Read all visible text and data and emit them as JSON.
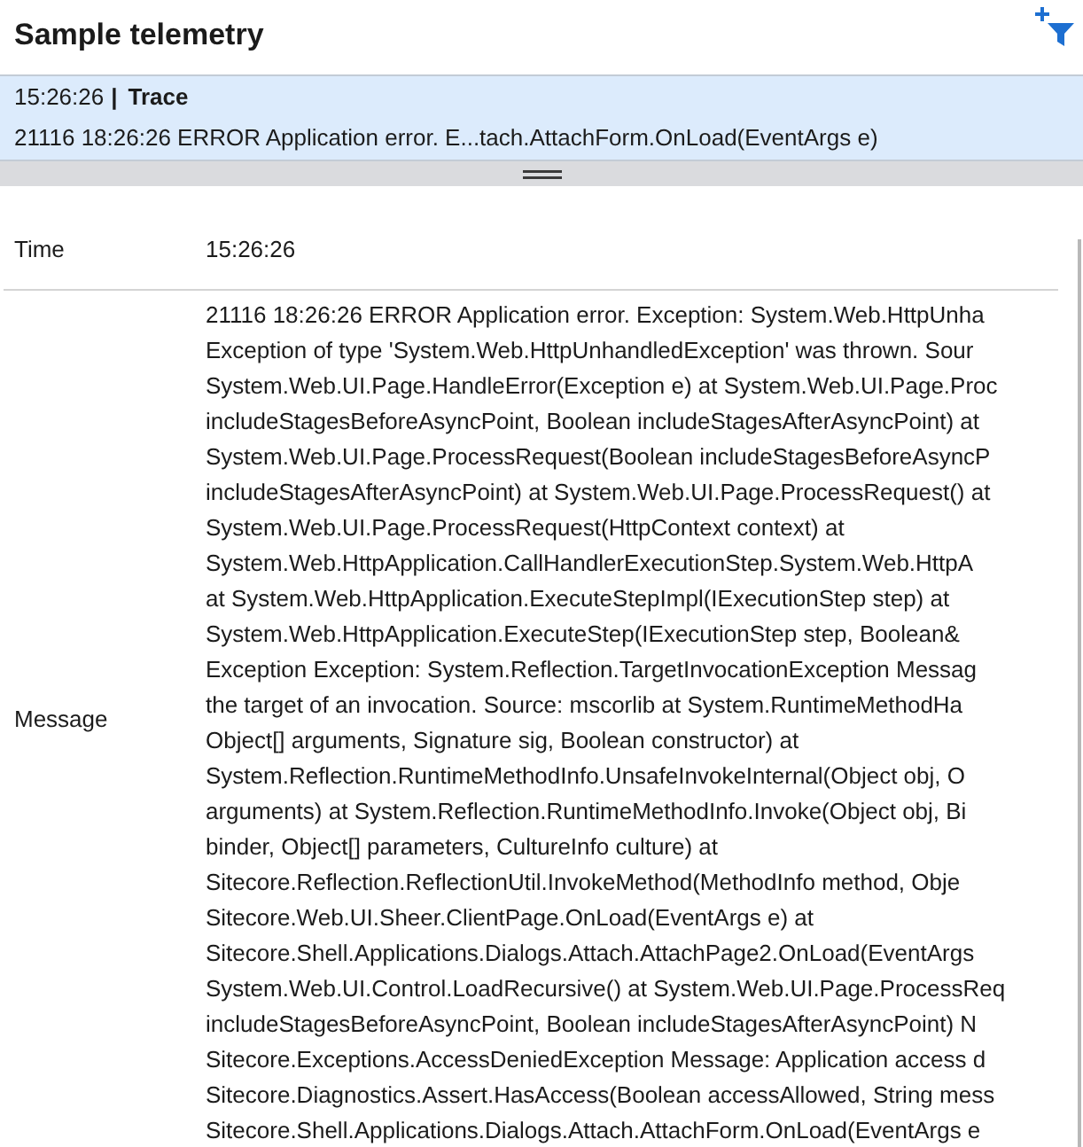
{
  "header": {
    "title": "Sample telemetry"
  },
  "list": {
    "items": [
      {
        "time": "15:26:26",
        "separator": "|",
        "severity": "Trace",
        "message": "21116 18:26:26 ERROR Application error. E...tach.AttachForm.OnLoad(EventArgs e)",
        "selected": true
      }
    ]
  },
  "details": {
    "rows": [
      {
        "kind": "text",
        "label": "Time",
        "value": "15:26:26"
      },
      {
        "kind": "lines",
        "label": "Message",
        "lines": [
          "21116 18:26:26 ERROR Application error. Exception: System.Web.HttpUnha",
          "Exception of type 'System.Web.HttpUnhandledException' was thrown. Sour",
          "System.Web.UI.Page.HandleError(Exception e) at System.Web.UI.Page.Proc",
          "includeStagesBeforeAsyncPoint, Boolean includeStagesAfterAsyncPoint) at",
          "System.Web.UI.Page.ProcessRequest(Boolean includeStagesBeforeAsyncP",
          "includeStagesAfterAsyncPoint) at System.Web.UI.Page.ProcessRequest() at",
          "System.Web.UI.Page.ProcessRequest(HttpContext context) at",
          "System.Web.HttpApplication.CallHandlerExecutionStep.System.Web.HttpA",
          "at System.Web.HttpApplication.ExecuteStepImpl(IExecutionStep step) at",
          "System.Web.HttpApplication.ExecuteStep(IExecutionStep step, Boolean&",
          "Exception Exception: System.Reflection.TargetInvocationException Messag",
          "the target of an invocation. Source: mscorlib at System.RuntimeMethodHa",
          "Object[] arguments, Signature sig, Boolean constructor) at",
          "System.Reflection.RuntimeMethodInfo.UnsafeInvokeInternal(Object obj, O",
          "arguments) at System.Reflection.RuntimeMethodInfo.Invoke(Object obj, Bi",
          "binder, Object[] parameters, CultureInfo culture) at",
          "Sitecore.Reflection.ReflectionUtil.InvokeMethod(MethodInfo method, Obje",
          "Sitecore.Web.UI.Sheer.ClientPage.OnLoad(EventArgs e) at",
          "Sitecore.Shell.Applications.Dialogs.Attach.AttachPage2.OnLoad(EventArgs",
          "System.Web.UI.Control.LoadRecursive() at System.Web.UI.Page.ProcessReq",
          "includeStagesBeforeAsyncPoint, Boolean includeStagesAfterAsyncPoint) N",
          "Sitecore.Exceptions.AccessDeniedException Message: Application access d",
          "Sitecore.Diagnostics.Assert.HasAccess(Boolean accessAllowed, String mess",
          "Sitecore.Shell.Applications.Dialogs.Attach.AttachForm.OnLoad(EventArgs e"
        ]
      }
    ]
  }
}
